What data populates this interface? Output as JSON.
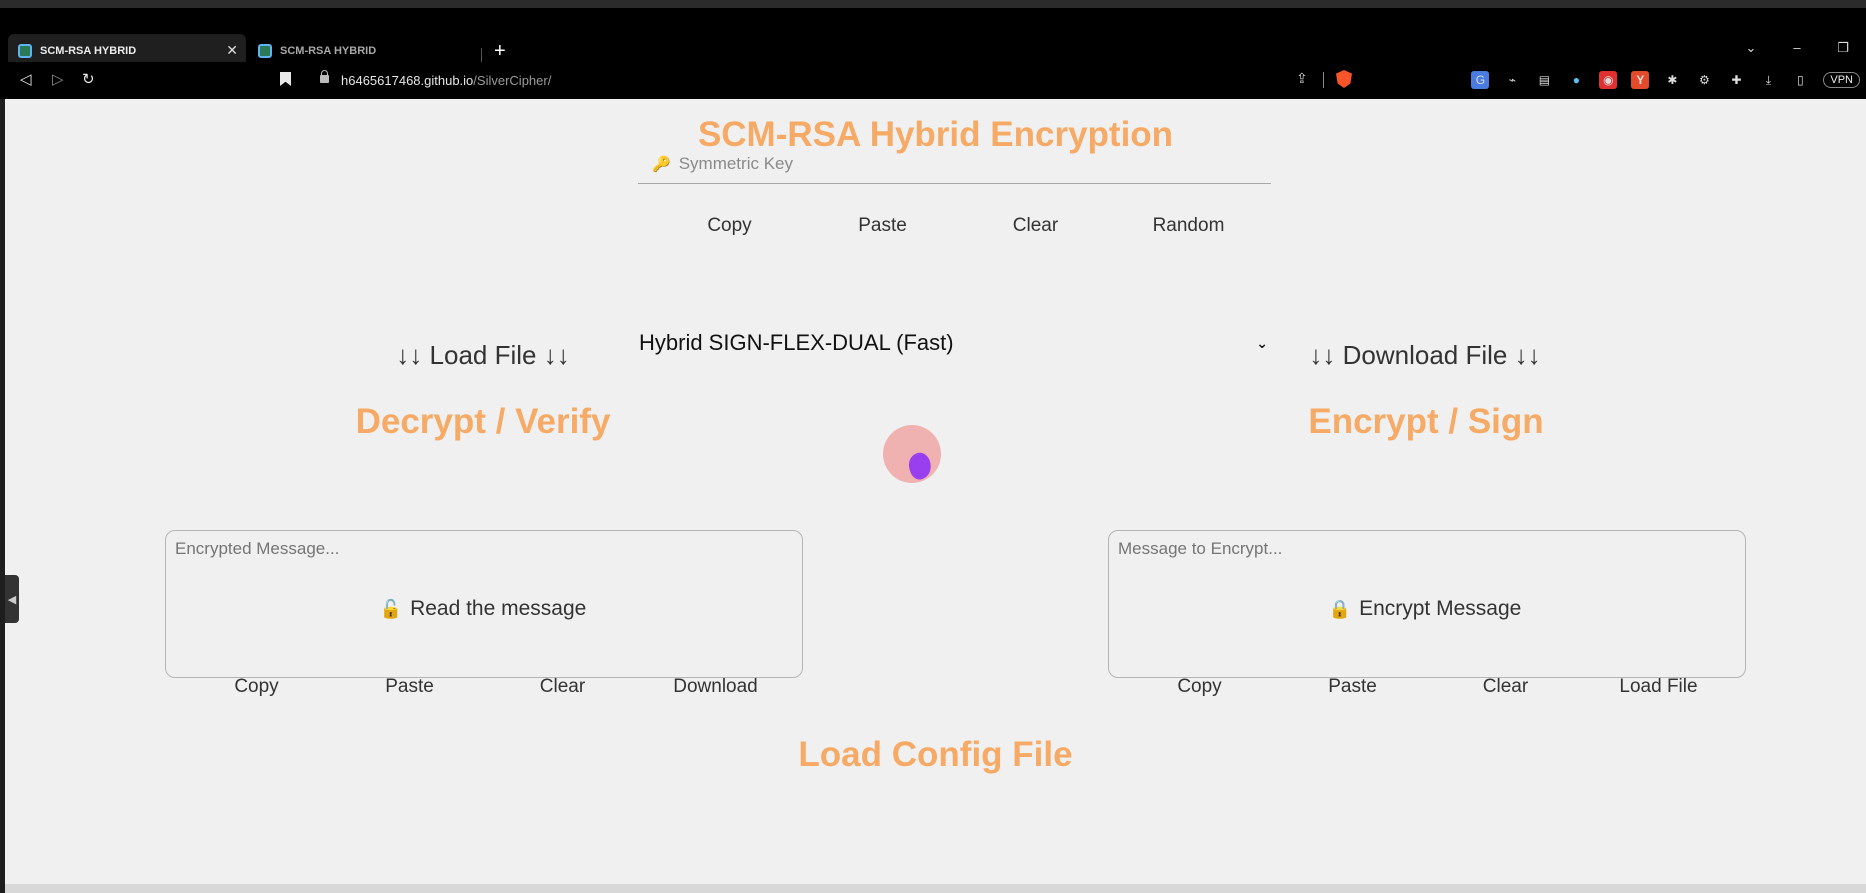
{
  "browser": {
    "tabs": [
      {
        "title": "SCM-RSA HYBRID",
        "active": true
      },
      {
        "title": "SCM-RSA HYBRID",
        "active": false
      }
    ],
    "url_host": "h6465617468.github.io",
    "url_path": "/SilverCipher/",
    "vpn_label": "VPN"
  },
  "page": {
    "title": "SCM-RSA Hybrid Encryption",
    "key_placeholder": "Symmetric Key",
    "key_buttons": [
      "Copy",
      "Paste",
      "Clear",
      "Random"
    ],
    "mode_select": "Hybrid SIGN-FLEX-DUAL (Fast)",
    "load_file": "↓↓ Load File ↓↓",
    "download_file": "↓↓ Download File ↓↓",
    "decrypt": {
      "title": "Decrypt / Verify",
      "placeholder": "Encrypted Message...",
      "action": "Read the message",
      "buttons": [
        "Copy",
        "Paste",
        "Clear",
        "Download"
      ]
    },
    "encrypt": {
      "title": "Encrypt / Sign",
      "placeholder": "Message to Encrypt...",
      "action": "Encrypt Message",
      "buttons": [
        "Copy",
        "Paste",
        "Clear",
        "Load File"
      ]
    },
    "config_title": "Load Config File"
  },
  "colors": {
    "accent": "#f6aa65",
    "background": "#f0f0f0"
  }
}
